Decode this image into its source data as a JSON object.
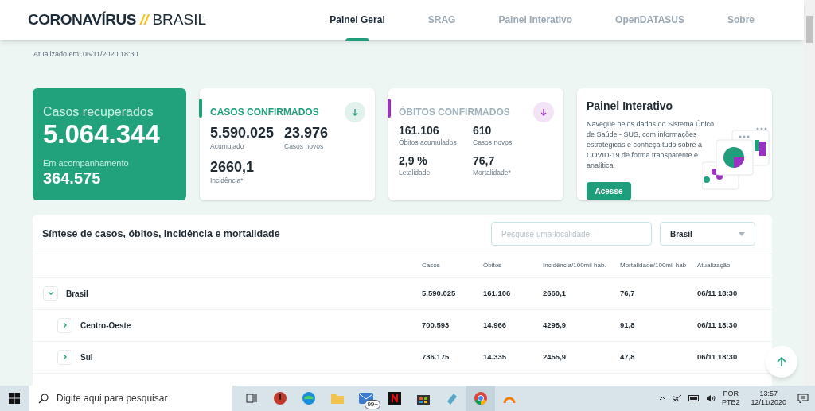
{
  "header": {
    "logo": {
      "main": "CORONAVÍRUS",
      "separator": "//",
      "sub": "BRASIL"
    },
    "nav": [
      {
        "label": "Painel Geral",
        "selected": true
      },
      {
        "label": "SRAG",
        "selected": false
      },
      {
        "label": "Painel Interativo",
        "selected": false
      },
      {
        "label": "OpenDATASUS",
        "selected": false
      },
      {
        "label": "Sobre",
        "selected": false
      }
    ]
  },
  "updated": {
    "label": "Atualizado em:",
    "value": "06/11/2020 18:30"
  },
  "cards": [
    {
      "kind": "highlight",
      "title": "Casos recuperados",
      "value": "5.064.344",
      "sub_label": "Em acompanhamento",
      "sub_value": "364.575"
    },
    {
      "kind": "stats",
      "title": "CASOS CONFIRMADOS",
      "color": "#1e9e7b",
      "stats": [
        {
          "value": "5.590.025",
          "label": "Acumulado"
        },
        {
          "value": "23.976",
          "label": "Casos novos"
        },
        {
          "value": "2660,1",
          "label": "Incidência*"
        }
      ]
    },
    {
      "kind": "stats",
      "title": "ÓBITOS CONFIRMADOS",
      "color": "#9b30c4",
      "stats": [
        {
          "value": "161.106",
          "label": "Óbitos acumulados"
        },
        {
          "value": "610",
          "label": "Casos novos"
        },
        {
          "value": "2,9 %",
          "label": "Letalidade"
        },
        {
          "value": "76,7",
          "label": "Mortalidade*"
        }
      ]
    },
    {
      "kind": "promo",
      "title": "Painel Interativo",
      "text": "Navegue pelos dados do Sistema Único de Saúde - SUS, com informações estratégicas e conheça tudo sobre a COVID-19 de forma transparente e analítica.",
      "button": "Acesse"
    }
  ],
  "table": {
    "title": "Síntese de casos, óbitos, incidência e mortalidade",
    "search": {
      "placeholder": "Pesquise uma localidade"
    },
    "select": {
      "value": "Brasil"
    },
    "columns": [
      "Casos",
      "Óbitos",
      "Incidência/100mil hab.",
      "Mortalidade/100mil hab",
      "Atualização"
    ],
    "rows": [
      {
        "name": "Brasil",
        "expanded": true,
        "cells": [
          "5.590.025",
          "161.106",
          "2660,1",
          "76,7",
          "06/11 18:30"
        ],
        "children": [
          {
            "name": "Centro-Oeste",
            "expanded": false,
            "cells": [
              "700.593",
              "14.966",
              "4298,9",
              "91,8",
              "06/11 18:30"
            ]
          },
          {
            "name": "Sul",
            "expanded": false,
            "cells": [
              "736.175",
              "14.335",
              "2455,9",
              "47,8",
              "06/11 18:30"
            ]
          }
        ]
      }
    ]
  },
  "taskbar": {
    "search": {
      "placeholder": "Digite aqui para pesquisar"
    },
    "mail_badge": "99+",
    "language": "POR",
    "layout": "PTB2",
    "time": "13:57",
    "date": "12/11/2020"
  }
}
